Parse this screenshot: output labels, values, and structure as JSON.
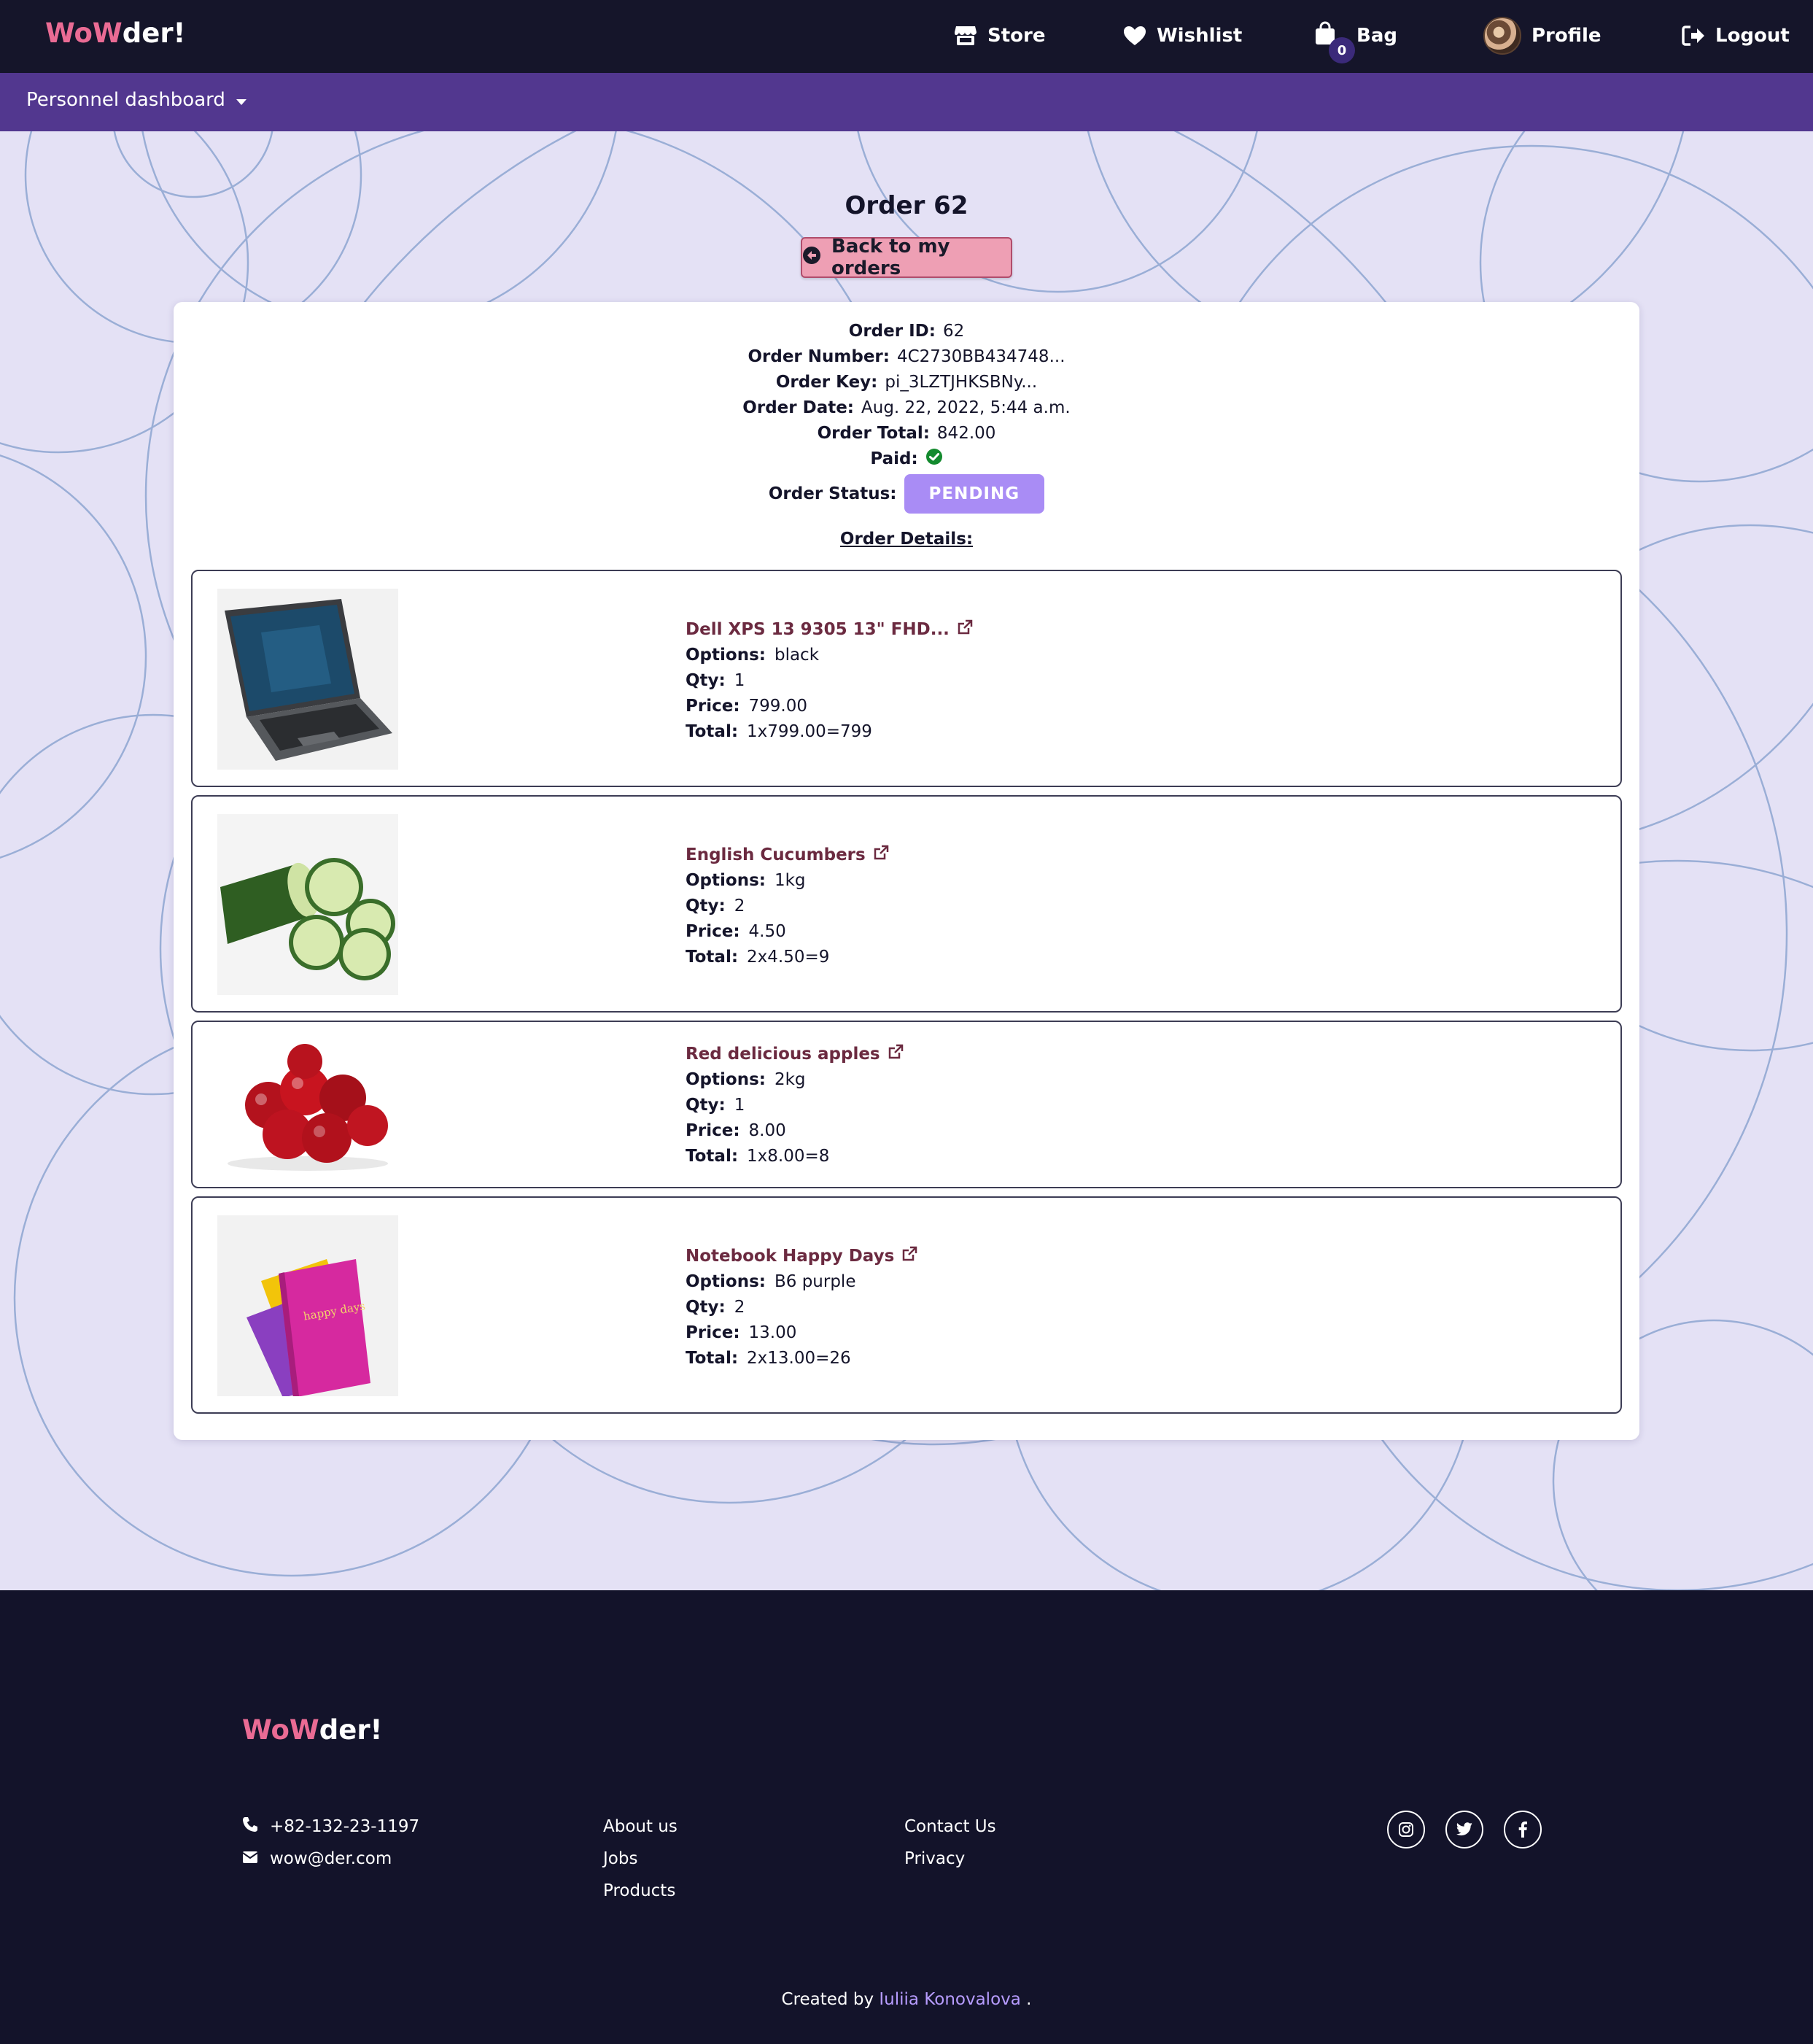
{
  "brand": {
    "part1": "WoW",
    "part2": "der!"
  },
  "nav": {
    "store": "Store",
    "wishlist": "Wishlist",
    "bag": "Bag",
    "bag_count": "0",
    "profile": "Profile",
    "logout": "Logout"
  },
  "subnav": {
    "dropdown_label": "Personnel dashboard"
  },
  "page": {
    "title": "Order 62",
    "back_button": "Back to my orders"
  },
  "order": {
    "id_label": "Order ID:",
    "id": "62",
    "number_label": "Order Number:",
    "number": "4C2730BB434748...",
    "key_label": "Order Key:",
    "key": "pi_3LZTJHKSBNy...",
    "date_label": "Order Date:",
    "date": "Aug. 22, 2022, 5:44 a.m.",
    "total_label": "Order Total:",
    "total": "842.00",
    "paid_label": "Paid:",
    "status_label": "Order Status:",
    "status": "PENDING",
    "details_title": "Order Details:"
  },
  "item_labels": {
    "options": "Options:",
    "qty": "Qty:",
    "price": "Price:",
    "total": "Total:"
  },
  "items": [
    {
      "name": "Dell XPS 13 9305 13\" FHD...",
      "options": "black",
      "qty": "1",
      "price": "799.00",
      "total": "1x799.00=799",
      "icon": "laptop-image"
    },
    {
      "name": "English Cucumbers",
      "options": "1kg",
      "qty": "2",
      "price": "4.50",
      "total": "2x4.50=9",
      "icon": "cucumber-image"
    },
    {
      "name": "Red delicious apples",
      "options": "2kg",
      "qty": "1",
      "price": "8.00",
      "total": "1x8.00=8",
      "icon": "apples-image"
    },
    {
      "name": "Notebook Happy Days",
      "options": "B6 purple",
      "qty": "2",
      "price": "13.00",
      "total": "2x13.00=26",
      "icon": "notebook-image",
      "image_text": "happy days"
    }
  ],
  "footer": {
    "phone": "+82-132-23-1197",
    "email": "wow@der.com",
    "links_col1": [
      "About us",
      "Jobs",
      "Products"
    ],
    "links_col2": [
      "Contact Us",
      "Privacy"
    ],
    "social": [
      "instagram-icon",
      "twitter-icon",
      "facebook-icon"
    ],
    "credit_prefix": "Created by",
    "credit_author": "Iuliia Konovalova",
    "credit_suffix": "."
  },
  "colors": {
    "navbar": "#15152a",
    "subnav": "#52378f",
    "page_bg": "#e4e1f5",
    "brand_pink": "#ea6b94",
    "status_badge": "#a98cf5",
    "back_button": "#ee9fb4",
    "paid_green": "#138a2e"
  }
}
